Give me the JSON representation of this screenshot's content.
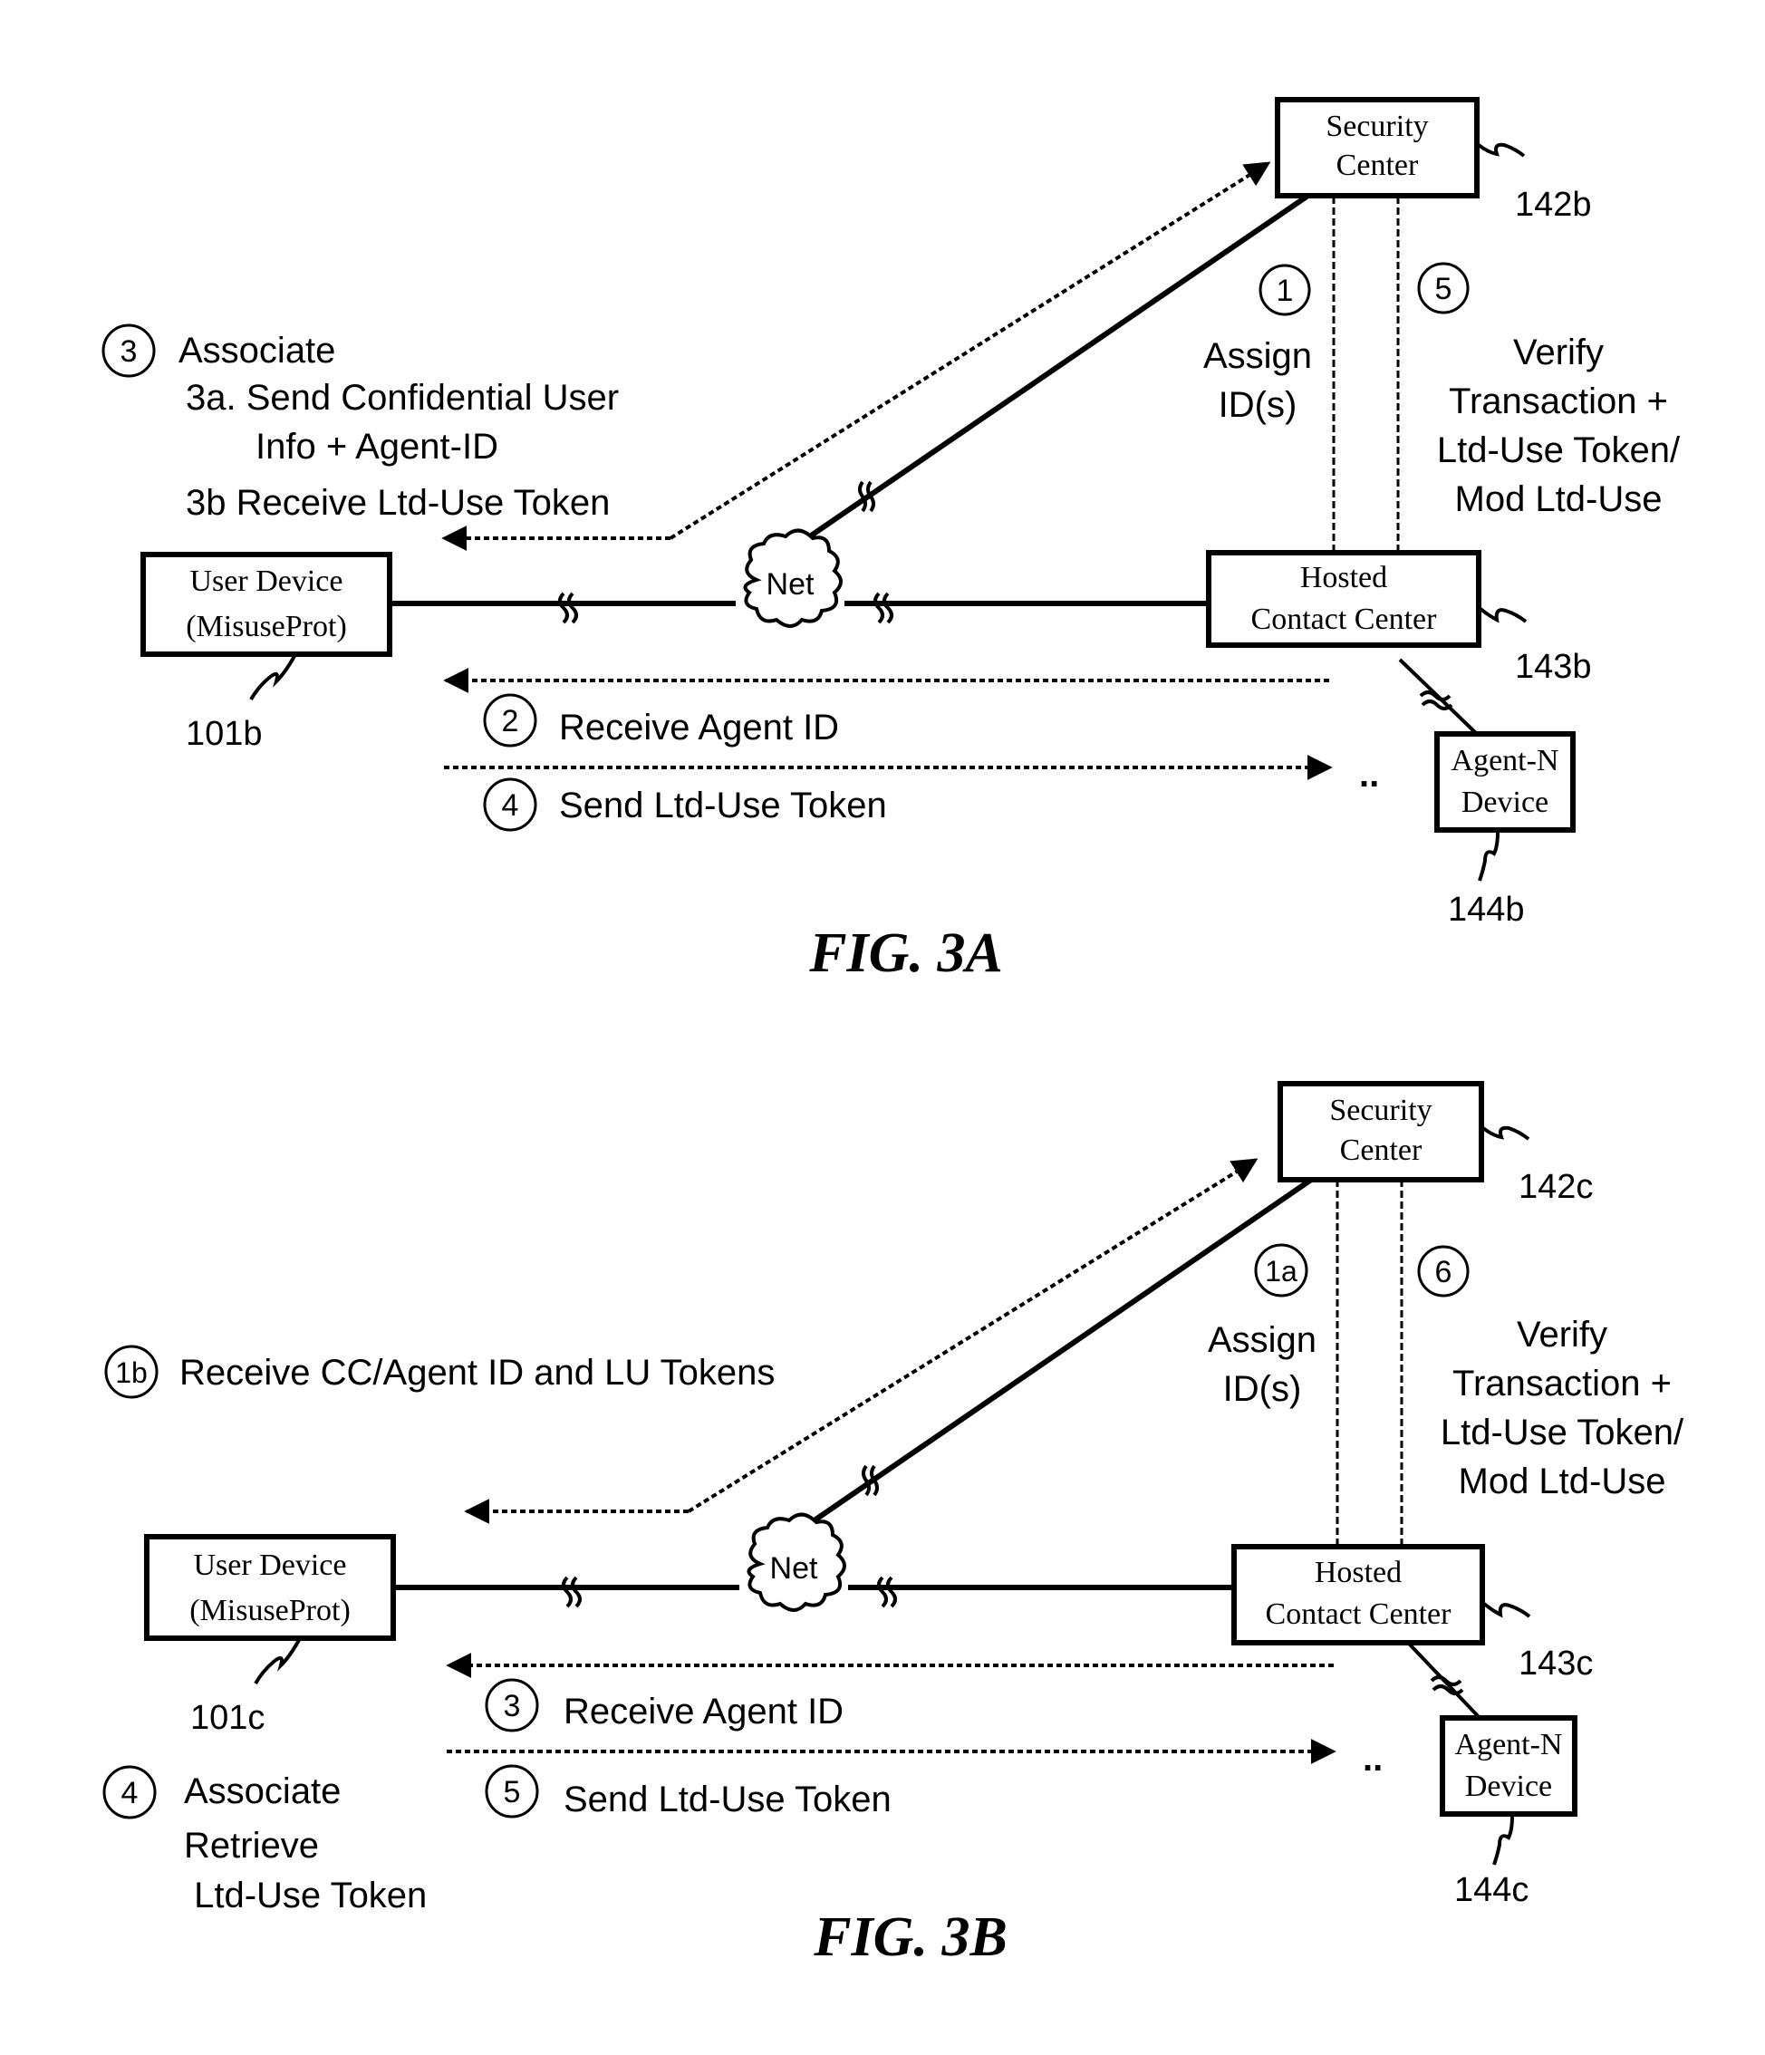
{
  "figures": [
    {
      "caption": "FIG. 3A",
      "security_center": {
        "line1": "Security",
        "line2": "Center",
        "ref": "142b"
      },
      "user_device": {
        "line1": "User Device",
        "line2": "(MisuseProt)",
        "ref": "101b"
      },
      "network": {
        "label": "Net"
      },
      "hosted_cc": {
        "line1": "Hosted",
        "line2": "Contact Center",
        "ref": "143b"
      },
      "agent_device": {
        "line1": "Agent-N",
        "line2": "Device",
        "ref": "144b"
      },
      "ellipsis": "..",
      "steps": {
        "assign": {
          "num": "1",
          "lines": [
            "Assign",
            "ID(s)"
          ]
        },
        "verify": {
          "num": "5",
          "lines": [
            "Verify",
            "Transaction +",
            "Ltd-Use Token/",
            "Mod Ltd-Use"
          ]
        },
        "associate": {
          "num": "3",
          "lines": [
            "Associate",
            "3a. Send Confidential User",
            "Info + Agent-ID",
            "3b Receive Ltd-Use Token"
          ]
        },
        "receive_agent": {
          "num": "2",
          "text": "Receive Agent ID"
        },
        "send_token": {
          "num": "4",
          "text": "Send Ltd-Use Token"
        }
      }
    },
    {
      "caption": "FIG. 3B",
      "security_center": {
        "line1": "Security",
        "line2": "Center",
        "ref": "142c"
      },
      "user_device": {
        "line1": "User Device",
        "line2": "(MisuseProt)",
        "ref": "101c"
      },
      "network": {
        "label": "Net"
      },
      "hosted_cc": {
        "line1": "Hosted",
        "line2": "Contact Center",
        "ref": "143c"
      },
      "agent_device": {
        "line1": "Agent-N",
        "line2": "Device",
        "ref": "144c"
      },
      "ellipsis": "..",
      "steps": {
        "assign": {
          "num": "1a",
          "lines": [
            "Assign",
            "ID(s)"
          ]
        },
        "verify": {
          "num": "6",
          "lines": [
            "Verify",
            "Transaction +",
            "Ltd-Use Token/",
            "Mod Ltd-Use"
          ]
        },
        "receive_tokens": {
          "num": "1b",
          "text": "Receive CC/Agent ID and LU Tokens"
        },
        "receive_agent": {
          "num": "3",
          "text": "Receive Agent ID"
        },
        "send_token": {
          "num": "5",
          "text": "Send Ltd-Use Token"
        },
        "associate": {
          "num": "4",
          "lines": [
            "Associate",
            "Retrieve",
            " Ltd-Use Token"
          ]
        }
      }
    }
  ]
}
